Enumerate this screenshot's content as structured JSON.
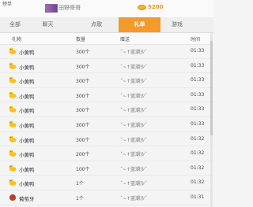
{
  "top": {
    "corner_label": "榜单",
    "username": "田野哥哥",
    "coins": "5200"
  },
  "tabs": [
    {
      "label": "全部",
      "active": false
    },
    {
      "label": "聊天",
      "active": false
    },
    {
      "label": "点歌",
      "active": false
    },
    {
      "label": "礼单",
      "active": true
    },
    {
      "label": "游戏",
      "active": false
    }
  ],
  "columns": {
    "gift": "礼物",
    "qty": "数量",
    "sender": "赠送",
    "time": "时间"
  },
  "rows": [
    {
      "icon": "duck-icon",
      "gift": "小黄鸭",
      "qty": "300个",
      "sender": "ˇ~↑蓝潮沙ˇ",
      "time": "01:33"
    },
    {
      "icon": "duck-icon",
      "gift": "小黄鸭",
      "qty": "300个",
      "sender": "ˇ~↑蓝潮沙ˇ",
      "time": "01:33"
    },
    {
      "icon": "duck-icon",
      "gift": "小黄鸭",
      "qty": "300个",
      "sender": "ˇ~↑蓝潮沙ˇ",
      "time": "01:33"
    },
    {
      "icon": "duck-icon",
      "gift": "小黄鸭",
      "qty": "300个",
      "sender": "ˇ~↑蓝潮沙ˇ",
      "time": "01:33"
    },
    {
      "icon": "duck-icon",
      "gift": "小黄鸭",
      "qty": "300个",
      "sender": "ˇ~↑蓝潮沙ˇ",
      "time": "01:33"
    },
    {
      "icon": "duck-icon",
      "gift": "小黄鸭",
      "qty": "300个",
      "sender": "ˇ~↑蓝潮沙ˇ",
      "time": "01:33"
    },
    {
      "icon": "duck-icon",
      "gift": "小黄鸭",
      "qty": "300个",
      "sender": "ˇ~↑蓝潮沙ˇ",
      "time": "01:32"
    },
    {
      "icon": "duck-icon",
      "gift": "小黄鸭",
      "qty": "200个",
      "sender": "ˇ~↑蓝潮沙ˇ",
      "time": "01:32"
    },
    {
      "icon": "duck-icon",
      "gift": "小黄鸭",
      "qty": "100个",
      "sender": "ˇ~↑蓝潮沙ˇ",
      "time": "01:32"
    },
    {
      "icon": "duck-icon",
      "gift": "小黄鸭",
      "qty": "1个",
      "sender": "ˇ~↑蓝潮沙ˇ",
      "time": "01:32"
    },
    {
      "icon": "grape-icon",
      "gift": "葡萄牙",
      "qty": "1个",
      "sender": "ˇ~↑蓝潮沙ˇ",
      "time": "01:31"
    }
  ],
  "colors": {
    "accent": "#f39a2c",
    "duck": "#f7c21b",
    "grape": "#c0392b"
  }
}
